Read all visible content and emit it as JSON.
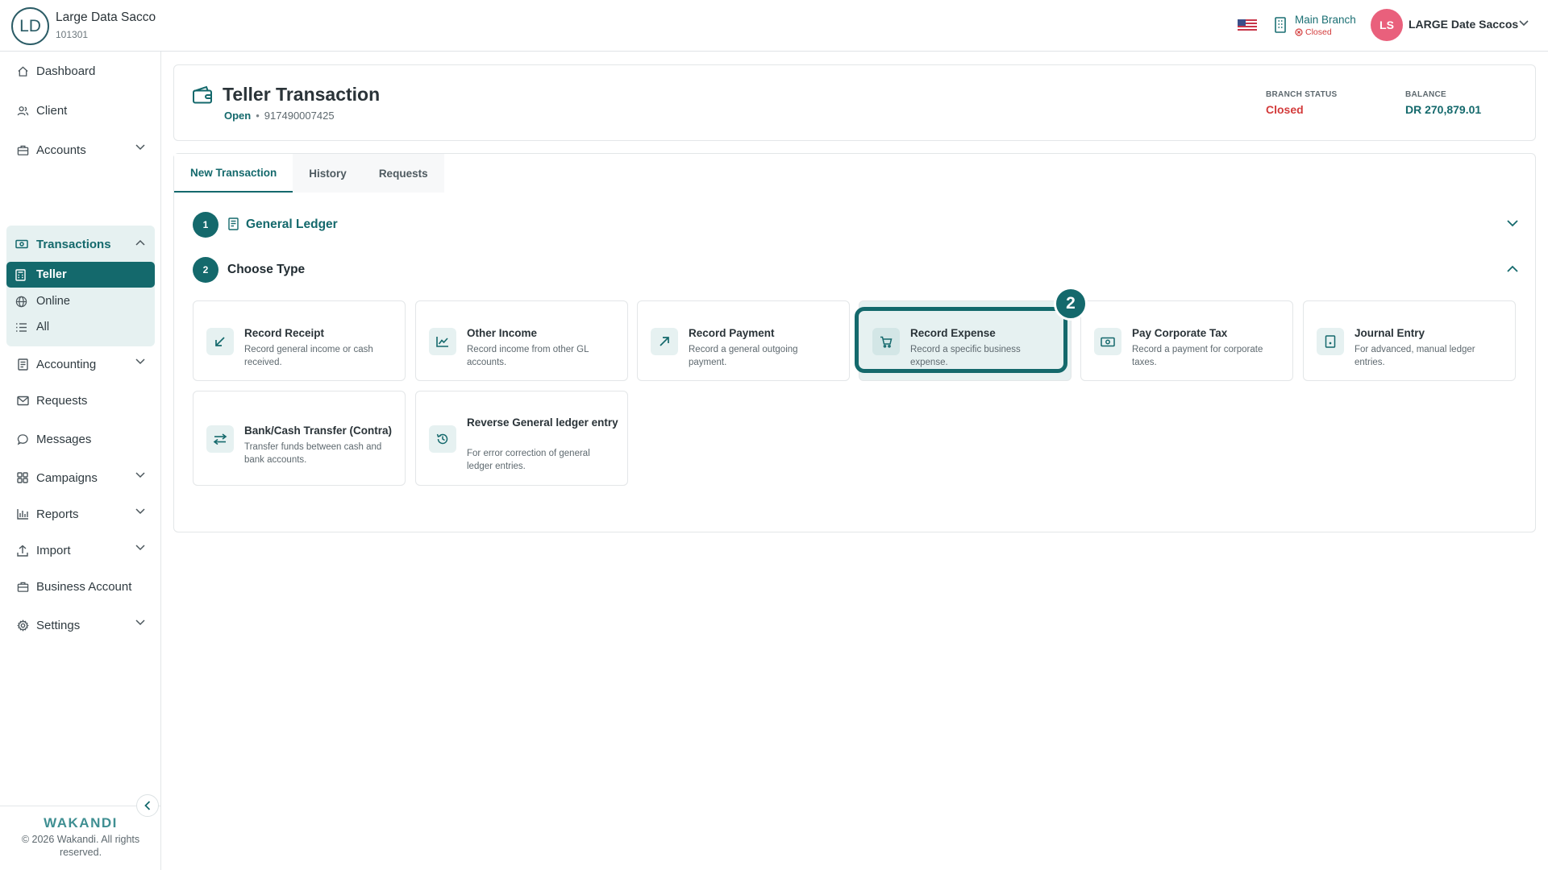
{
  "org": {
    "initials": "LD",
    "name": "Large Data Sacco",
    "code": "101301"
  },
  "topbar": {
    "branch_name": "Main Branch",
    "branch_status": "Closed",
    "user_initials": "LS",
    "user_name": "LARGE Date Saccos"
  },
  "sidebar": {
    "items": [
      {
        "label": "Dashboard",
        "icon": "home-icon"
      },
      {
        "label": "Client",
        "icon": "users-icon"
      },
      {
        "label": "Accounts",
        "icon": "briefcase-icon",
        "expandable": true
      },
      {
        "label": "Transactions",
        "icon": "money-icon",
        "expanded": true
      },
      {
        "label": "Accounting",
        "icon": "ledger-icon",
        "expandable": true
      },
      {
        "label": "Requests",
        "icon": "mail-icon"
      },
      {
        "label": "Messages",
        "icon": "chat-icon"
      },
      {
        "label": "Campaigns",
        "icon": "grid-icon",
        "expandable": true
      },
      {
        "label": "Reports",
        "icon": "bar-chart-icon",
        "expandable": true
      },
      {
        "label": "Import",
        "icon": "upload-icon",
        "expandable": true
      },
      {
        "label": "Business Account",
        "icon": "briefcase-icon"
      },
      {
        "label": "Settings",
        "icon": "gear-icon",
        "expandable": true
      }
    ],
    "transactions_sub": [
      {
        "label": "Teller",
        "icon": "calculator-icon",
        "active": true
      },
      {
        "label": "Online",
        "icon": "globe-icon"
      },
      {
        "label": "All",
        "icon": "list-icon"
      }
    ],
    "brand": "WAKANDI",
    "copyright": "© 2026 Wakandi. All rights reserved."
  },
  "header": {
    "title": "Teller Transaction",
    "status": "Open",
    "separator": "•",
    "till_number": "917490007425",
    "branch_status_label": "BRANCH STATUS",
    "branch_status_value": "Closed",
    "balance_label": "BALANCE",
    "balance_value": "DR 270,879.01"
  },
  "tabs": [
    "New Transaction",
    "History",
    "Requests"
  ],
  "active_tab": "New Transaction",
  "steps": [
    {
      "number": "1",
      "title": "General Ledger",
      "state": "collapsed"
    },
    {
      "number": "2",
      "title": "Choose Type",
      "state": "expanded"
    }
  ],
  "options": [
    {
      "title": "Record Receipt",
      "desc": "Record general income or cash received.",
      "icon": "arrow-down-left-icon"
    },
    {
      "title": "Other Income",
      "desc": "Record income from other GL accounts.",
      "icon": "trend-chart-icon"
    },
    {
      "title": "Record Payment",
      "desc": "Record a general outgoing payment.",
      "icon": "arrow-up-right-icon"
    },
    {
      "title": "Record Expense",
      "desc": "Record a specific business expense.",
      "icon": "cart-icon",
      "selected": true
    },
    {
      "title": "Pay Corporate Tax",
      "desc": "Record a payment for corporate taxes.",
      "icon": "banknote-icon"
    },
    {
      "title": "Journal Entry",
      "desc": "For advanced, manual ledger entries.",
      "icon": "book-icon"
    },
    {
      "title": "Bank/Cash Transfer (Contra)",
      "desc": "Transfer funds between cash and bank accounts.",
      "icon": "swap-icon"
    },
    {
      "title": "Reverse General ledger entry",
      "desc": "For error correction of general ledger entries.",
      "icon": "history-icon"
    }
  ],
  "highlight_badge": "2",
  "colors": {
    "primary": "#14696c",
    "danger": "#d33b3b",
    "avatar": "#e9607c",
    "selected_bg": "#e6f1f1"
  }
}
